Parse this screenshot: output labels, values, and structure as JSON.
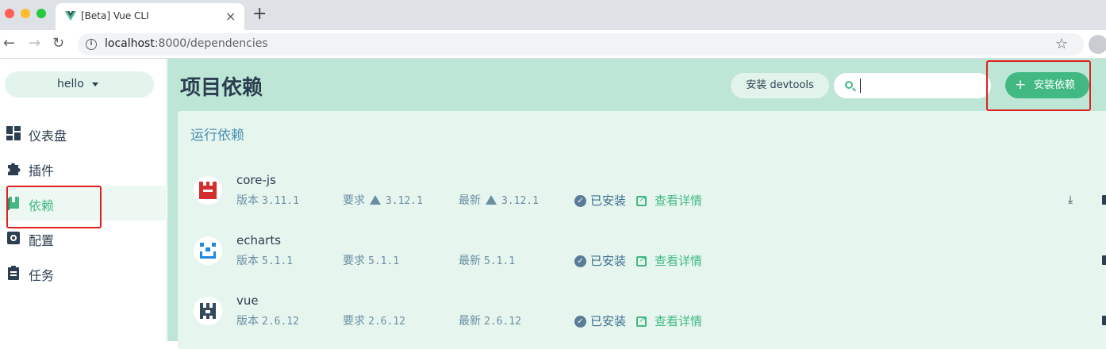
{
  "browser": {
    "tab_title": "[Beta] Vue CLI",
    "url_host": "localhost",
    "url_rest": ":8000/dependencies"
  },
  "sidebar": {
    "project": "hello",
    "items": [
      {
        "label": "仪表盘",
        "icon": "dashboard-icon"
      },
      {
        "label": "插件",
        "icon": "puzzle-icon"
      },
      {
        "label": "依赖",
        "icon": "book-icon",
        "active": true
      },
      {
        "label": "配置",
        "icon": "gear-icon"
      },
      {
        "label": "任务",
        "icon": "clipboard-icon"
      }
    ]
  },
  "main": {
    "title": "项目依赖",
    "devtools_label": "安装 devtools",
    "install_label": "安装依赖",
    "section": "运行依赖",
    "labels": {
      "version": "版本",
      "wanted": "要求",
      "latest": "最新",
      "installed": "已安装",
      "details": "查看详情"
    },
    "deps": [
      {
        "name": "core-js",
        "version": "3.11.1",
        "wanted": "3.12.1",
        "latest": "3.12.1",
        "outdated": true
      },
      {
        "name": "echarts",
        "version": "5.1.1",
        "wanted": "5.1.1",
        "latest": "5.1.1",
        "outdated": false
      },
      {
        "name": "vue",
        "version": "2.6.12",
        "wanted": "2.6.12",
        "latest": "2.6.12",
        "outdated": false
      }
    ]
  },
  "colors": {
    "accent": "#42b983",
    "main_bg": "#bde6d6",
    "panel_bg": "#e6f6ef",
    "highlight": "#e02020"
  }
}
